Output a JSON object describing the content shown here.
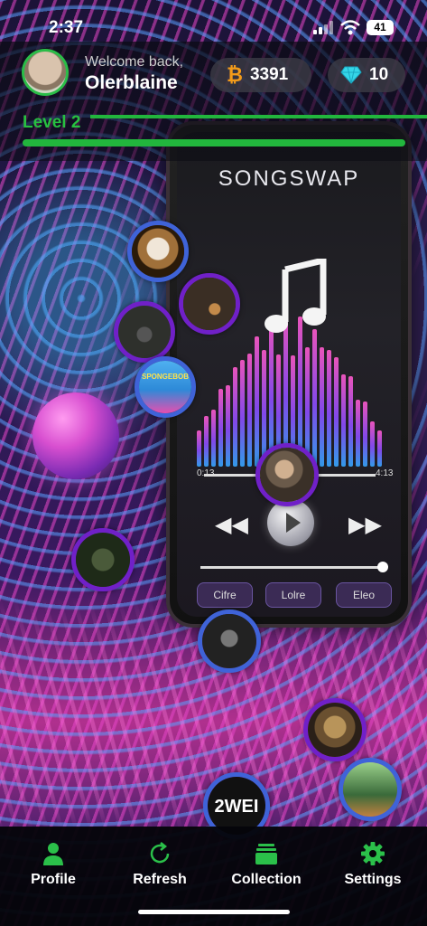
{
  "status_bar": {
    "time": "2:37",
    "battery": "41"
  },
  "header": {
    "welcome": "Welcome back,",
    "username": "Olerblaine",
    "coins": "3391",
    "gems": "10",
    "level": "Level 2",
    "level_progress": 1.0
  },
  "phone_mockup": {
    "app_title": "SONGSWAP",
    "time_left": "0:13",
    "time_right": "4:13",
    "buttons": [
      "Cifre",
      "Lolre",
      "Eleo"
    ]
  },
  "song_bubbles": [
    {
      "id": "1",
      "label": "",
      "color": "#a0703a"
    },
    {
      "id": "2",
      "label": "",
      "color": "#5a4a3a"
    },
    {
      "id": "3",
      "label": "",
      "color": "#3a3a3a"
    },
    {
      "id": "4",
      "label": "SPONGEBOB",
      "color": "#2e8ad8"
    },
    {
      "id": "5",
      "label": "",
      "color": "#6a5a4a"
    },
    {
      "id": "6",
      "label": "",
      "color": "#2e3a2a"
    },
    {
      "id": "7",
      "label": "",
      "color": "#2a2a2a"
    },
    {
      "id": "8",
      "label": "",
      "color": "#6a5030"
    },
    {
      "id": "9",
      "label": "",
      "color": "#3a6a3a"
    },
    {
      "id": "10",
      "label": "2WEI",
      "color": "#111111"
    }
  ],
  "nav": [
    {
      "label": "Profile",
      "icon": "person-icon"
    },
    {
      "label": "Refresh",
      "icon": "refresh-icon"
    },
    {
      "label": "Collection",
      "icon": "collection-icon"
    },
    {
      "label": "Settings",
      "icon": "gear-icon"
    }
  ],
  "colors": {
    "accent_green": "#27c040",
    "bubble_purple": "#7020c8",
    "bubble_blue": "#3f63d8"
  }
}
